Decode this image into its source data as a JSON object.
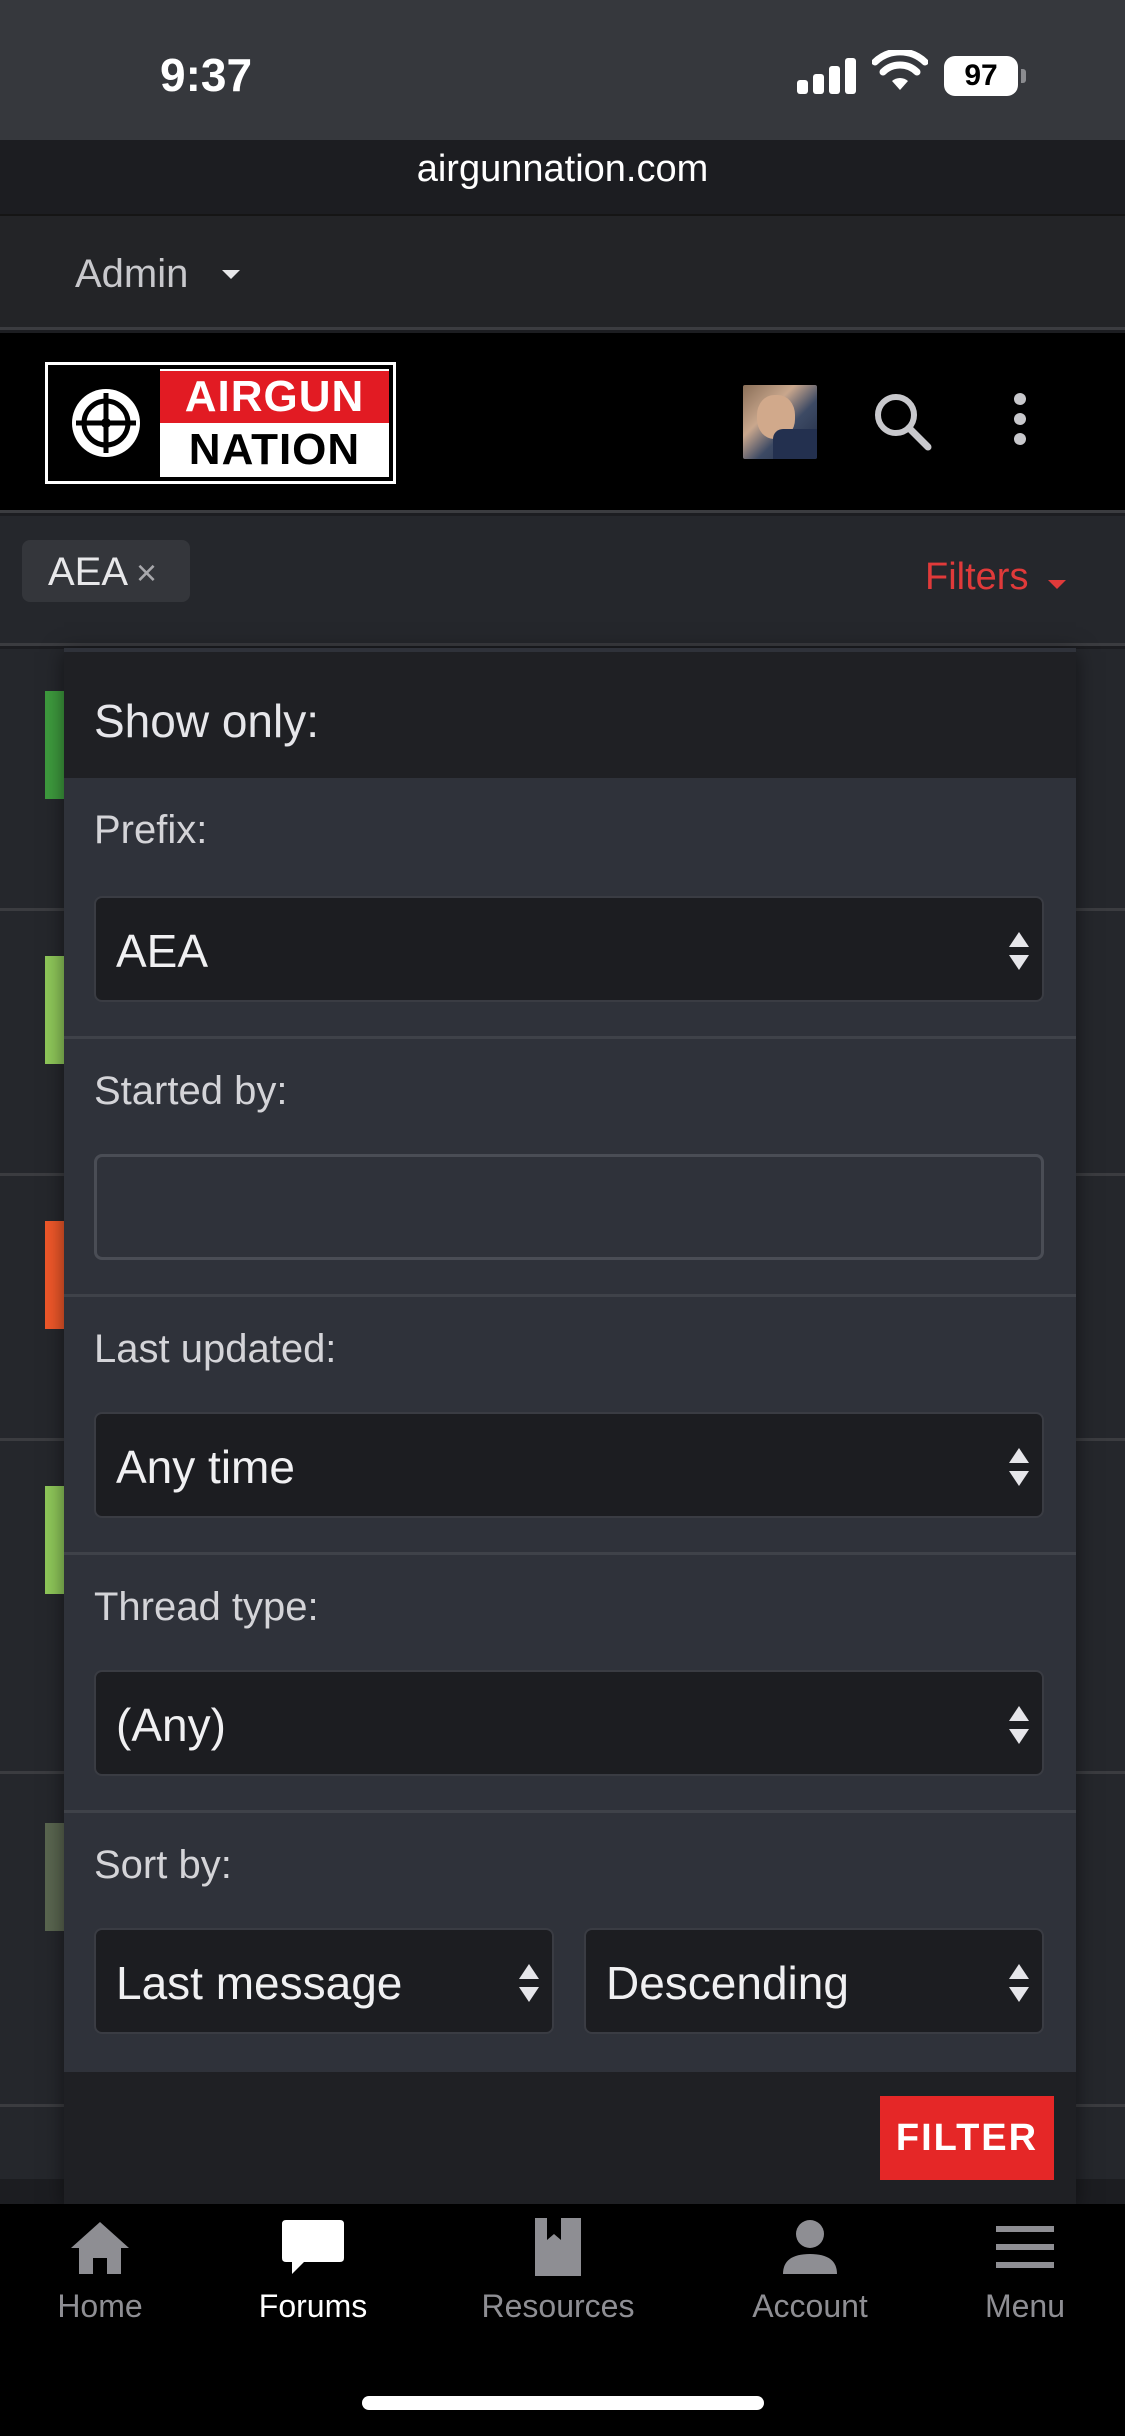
{
  "status_bar": {
    "time": "9:37",
    "battery": "97",
    "url": "airgunnation.com"
  },
  "admin_bar": {
    "label": "Admin"
  },
  "header": {
    "logo_line1": "AIRGUN",
    "logo_line2": "NATION",
    "icons": [
      "avatar",
      "search-icon",
      "more-vertical-icon"
    ]
  },
  "filter_bar": {
    "active_chip": "AEA",
    "chip_remove": "×",
    "filters_label": "Filters"
  },
  "thread_accents": [
    "#3e9b3e",
    "#8fc85a",
    "#f0582a",
    "#8fc85a"
  ],
  "panel": {
    "title": "Show only:",
    "prefix_label": "Prefix:",
    "prefix_value": "AEA",
    "started_by_label": "Started by:",
    "started_by_value": "",
    "last_updated_label": "Last updated:",
    "last_updated_value": "Any time",
    "thread_type_label": "Thread type:",
    "thread_type_value": "(Any)",
    "sort_by_label": "Sort by:",
    "sort_field_value": "Last message",
    "sort_dir_value": "Descending",
    "submit_label": "FILTER"
  },
  "bottom_nav": {
    "items": [
      {
        "label": "Home",
        "icon": "home-icon",
        "active": false
      },
      {
        "label": "Forums",
        "icon": "chat-bubble-icon",
        "active": true
      },
      {
        "label": "Resources",
        "icon": "book-icon",
        "active": false
      },
      {
        "label": "Account",
        "icon": "person-icon",
        "active": false
      },
      {
        "label": "Menu",
        "icon": "hamburger-icon",
        "active": false
      }
    ]
  },
  "colors": {
    "accent_red": "#e52727",
    "link_red": "#e03a3a"
  }
}
